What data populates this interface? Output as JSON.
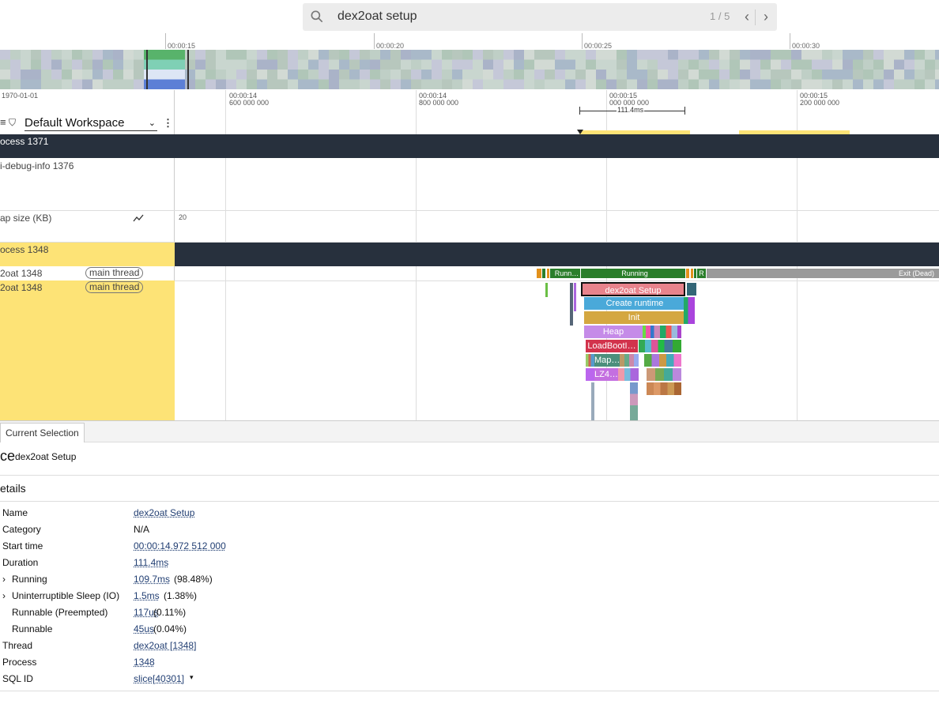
{
  "search": {
    "value": "dex2oat setup",
    "count": "1 / 5"
  },
  "overview": {
    "ticks": [
      "00:00:15",
      "00:00:20",
      "00:00:25",
      "00:00:30"
    ]
  },
  "timeaxis": {
    "date": "1970-01-01",
    "labels": [
      {
        "t": "00:00:14",
        "n": "600 000 000"
      },
      {
        "t": "00:00:14",
        "n": "800 000 000"
      },
      {
        "t": "00:00:15",
        "n": "000 000 000"
      },
      {
        "t": "00:00:15",
        "n": "200 000 000"
      }
    ],
    "span_label": "111.4ms"
  },
  "workspace": {
    "label": "Default Workspace"
  },
  "tracks": {
    "process_1371": "ocess 1371",
    "debug_info": "i-debug-info 1376",
    "heap_size": "ap size (KB)",
    "heap_value": "20",
    "process_1348": "ocess 1348",
    "thread_a": "2oat 1348",
    "thread_b": "2oat 1348",
    "main_thread": "main thread"
  },
  "slices": {
    "runn": "Runn…",
    "running": "Running",
    "r": "R",
    "exit": "Exit (Dead)",
    "setup": "dex2oat Setup",
    "create_runtime": "Create runtime",
    "init": "Init",
    "heap": "Heap",
    "loadboot": "LoadBootI…",
    "map": "Map…",
    "lz4": "LZ4…"
  },
  "details": {
    "tab": "Current Selection",
    "heading_prefix": "ce",
    "heading_title": "dex2oat Setup",
    "section": "etails",
    "rows": [
      {
        "key": "Name",
        "value": "dex2oat Setup",
        "extra": ""
      },
      {
        "key": "Category",
        "value": "N/A",
        "extra": ""
      },
      {
        "key": "Start time",
        "value": "00:00:14.972 512 000",
        "extra": ""
      },
      {
        "key": "Duration",
        "value": "111.4ms",
        "extra": ""
      },
      {
        "key": "Running",
        "value": "109.7ms",
        "extra": "(98.48%)"
      },
      {
        "key": "Uninterruptible Sleep (IO)",
        "value": "1.5ms",
        "extra": "(1.38%)"
      },
      {
        "key": "Runnable (Preempted)",
        "value": "117us",
        "extra": "(0.11%)"
      },
      {
        "key": "Runnable",
        "value": "45us",
        "extra": "(0.04%)"
      },
      {
        "key": "Thread",
        "value": "dex2oat [1348]",
        "extra": ""
      },
      {
        "key": "Process",
        "value": "1348",
        "extra": ""
      },
      {
        "key": "SQL ID",
        "value": "slice[40301]",
        "extra": ""
      }
    ]
  },
  "colors": {
    "dark_track": "#27303d",
    "yellow": "#fde376",
    "running_green": "#2b7e2b",
    "selected_slice": "#e8838c"
  }
}
